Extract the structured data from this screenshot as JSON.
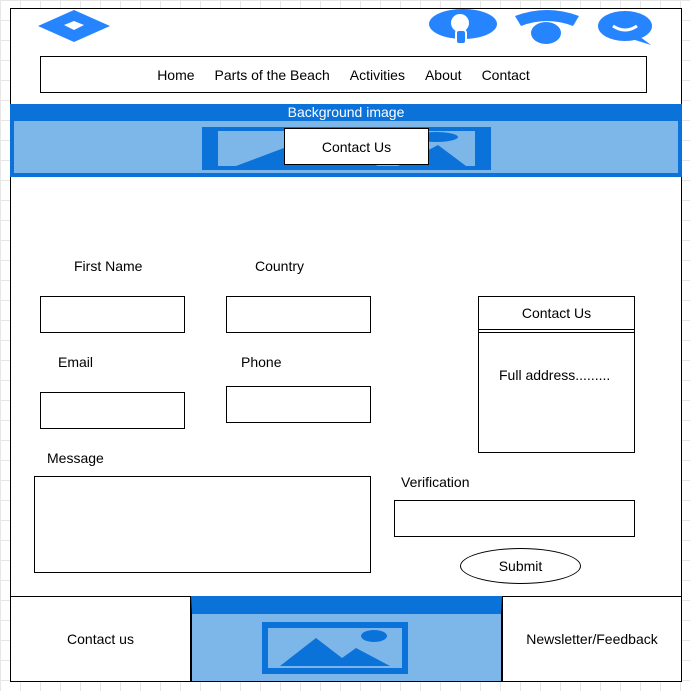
{
  "nav": {
    "items": [
      "Home",
      "Parts of the Beach",
      "Activities",
      "About",
      "Contact"
    ]
  },
  "hero": {
    "caption": "Background image",
    "cta_label": "Contact Us"
  },
  "form": {
    "first_name_label": "First Name",
    "country_label": "Country",
    "email_label": "Email",
    "phone_label": "Phone",
    "message_label": "Message",
    "verification_label": "Verification",
    "submit_label": "Submit"
  },
  "contact_card": {
    "title": "Contact Us",
    "address": "Full address........."
  },
  "footer": {
    "left_label": "Contact us",
    "right_label": "Newsletter/Feedback"
  },
  "colors": {
    "accent": "#0a72d8",
    "accent_light": "#7db7ea",
    "icon_blue": "#2684ff"
  },
  "icons": [
    "logo-icon",
    "location-icon",
    "wifi-icon",
    "chat-icon",
    "image-placeholder-icon"
  ]
}
